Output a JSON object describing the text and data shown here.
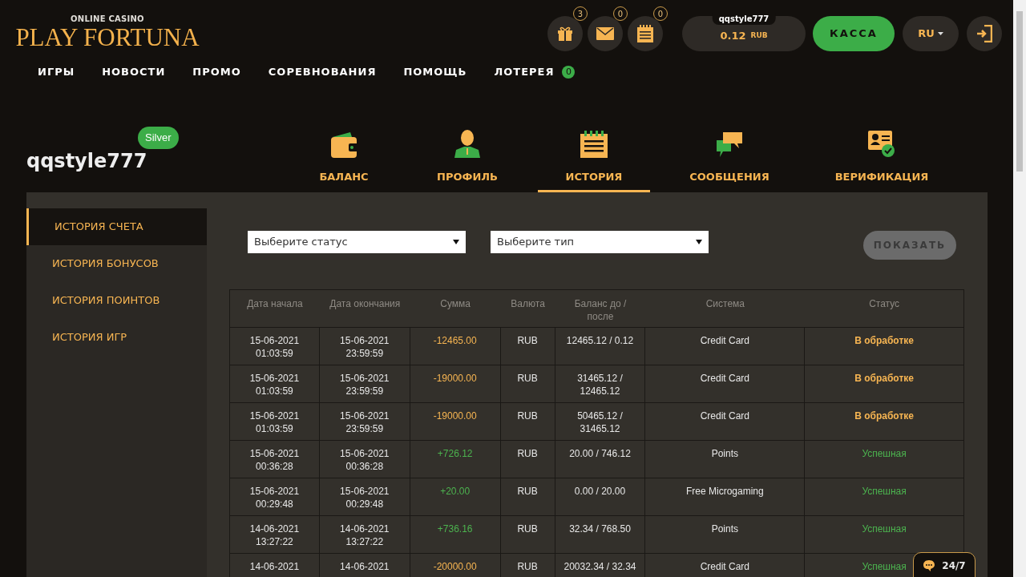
{
  "logo": {
    "tagline": "ONLINE CASINO",
    "name": "PLAY FORTUNA"
  },
  "header_icons": [
    {
      "kind": "gift",
      "count": "3"
    },
    {
      "kind": "mail",
      "count": "0"
    },
    {
      "kind": "notes",
      "count": "0"
    }
  ],
  "balance": {
    "username": "qqstyle777",
    "amount": "0.12",
    "currency": "RUB"
  },
  "cashier_button": "КАССА",
  "language": "RU",
  "nav": [
    {
      "label": "ИГРЫ"
    },
    {
      "label": "НОВОСТИ"
    },
    {
      "label": "ПРОМО"
    },
    {
      "label": "СОРЕВНОВАНИЯ"
    },
    {
      "label": "ПОМОЩЬ"
    },
    {
      "label": "ЛОТЕРЕЯ",
      "badge": "0"
    }
  ],
  "profile": {
    "username": "qqstyle777",
    "level": "Silver"
  },
  "tabs": [
    {
      "kind": "wallet",
      "label": "БАЛАНС",
      "selected": false
    },
    {
      "kind": "person",
      "label": "ПРОФИЛЬ",
      "selected": false
    },
    {
      "kind": "notes",
      "label": "ИСТОРИЯ",
      "selected": true
    },
    {
      "kind": "chat",
      "label": "СООБЩЕНИЯ",
      "selected": false
    },
    {
      "kind": "id",
      "label": "ВЕРИФИКАЦИЯ",
      "selected": false
    }
  ],
  "sidebar": {
    "items": [
      {
        "label": "ИСТОРИЯ СЧЕТА",
        "selected": true
      },
      {
        "label": "ИСТОРИЯ БОНУСОВ",
        "selected": false
      },
      {
        "label": "ИСТОРИЯ ПОИНТОВ",
        "selected": false
      },
      {
        "label": "ИСТОРИЯ ИГР",
        "selected": false
      }
    ]
  },
  "filters": {
    "status": {
      "placeholder": "Выберите статус"
    },
    "type": {
      "placeholder": "Выберите тип"
    },
    "show_button": {
      "label": "ПОКАЗАТЬ",
      "disabled": true
    }
  },
  "table": {
    "columns": [
      "Дата начала",
      "Дата окончания",
      "Сумма",
      "Валюта",
      "Баланс до / после",
      "Система",
      "Статус"
    ],
    "rows": [
      {
        "start": "15-06-2021 01:03:59",
        "end": "15-06-2021 23:59:59",
        "amount": "-12465.00",
        "debit": true,
        "currency": "RUB",
        "balance": "12465.12 / 0.12",
        "system": "Credit Card",
        "status": "В обработке",
        "pending": true
      },
      {
        "start": "15-06-2021 01:03:59",
        "end": "15-06-2021 23:59:59",
        "amount": "-19000.00",
        "debit": true,
        "currency": "RUB",
        "balance": "31465.12 / 12465.12",
        "system": "Credit Card",
        "status": "В обработке",
        "pending": true
      },
      {
        "start": "15-06-2021 01:03:59",
        "end": "15-06-2021 23:59:59",
        "amount": "-19000.00",
        "debit": true,
        "currency": "RUB",
        "balance": "50465.12 / 31465.12",
        "system": "Credit Card",
        "status": "В обработке",
        "pending": true
      },
      {
        "start": "15-06-2021 00:36:28",
        "end": "15-06-2021 00:36:28",
        "amount": "+726.12",
        "debit": false,
        "currency": "RUB",
        "balance": "20.00 / 746.12",
        "system": "Points",
        "status": "Успешная",
        "pending": false
      },
      {
        "start": "15-06-2021 00:29:48",
        "end": "15-06-2021 00:29:48",
        "amount": "+20.00",
        "debit": false,
        "currency": "RUB",
        "balance": "0.00 / 20.00",
        "system": "Free Microgaming",
        "status": "Успешная",
        "pending": false
      },
      {
        "start": "14-06-2021 13:27:22",
        "end": "14-06-2021 13:27:22",
        "amount": "+736.16",
        "debit": false,
        "currency": "RUB",
        "balance": "32.34 / 768.50",
        "system": "Points",
        "status": "Успешная",
        "pending": false
      },
      {
        "start": "14-06-2021",
        "end": "14-06-2021",
        "amount": "-20000.00",
        "debit": true,
        "currency": "RUB",
        "balance": "20032.34 / 32.34",
        "system": "Credit Card",
        "status": "Успешная",
        "pending": false
      }
    ]
  },
  "chat_button": "24/7"
}
